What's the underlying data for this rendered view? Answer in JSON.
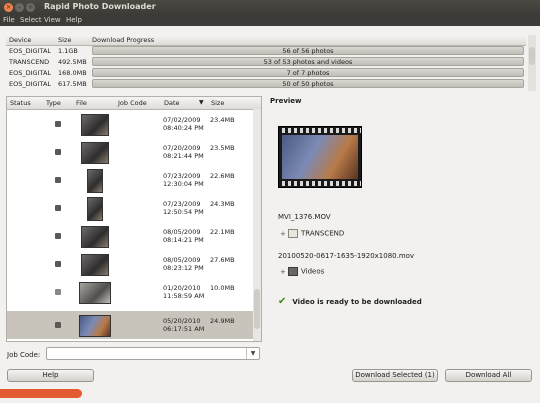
{
  "window": {
    "title": "Rapid Photo Downloader"
  },
  "menu": [
    "File",
    "Select",
    "View",
    "Help"
  ],
  "device_table": {
    "headers": {
      "device": "Device",
      "size": "Size",
      "progress": "Download Progress"
    },
    "rows": [
      {
        "device": "EOS_DIGITAL",
        "size": "1.1GB",
        "progress": "56 of 56 photos"
      },
      {
        "device": "TRANSCEND",
        "size": "492.5MB",
        "progress": "53 of 53 photos and videos"
      },
      {
        "device": "EOS_DIGITAL",
        "size": "168.0MB",
        "progress": "7 of 7 photos"
      },
      {
        "device": "EOS_DIGITAL",
        "size": "617.5MB",
        "progress": "50 of 50 photos"
      }
    ]
  },
  "file_table": {
    "headers": {
      "status": "Status",
      "type": "Type",
      "file": "File",
      "job_code": "Job Code",
      "date": "Date",
      "sort_icon": "▼",
      "size": "Size"
    },
    "rows": [
      {
        "date": "07/02/2009",
        "time": "08:40:24 PM",
        "size": "23.4MB"
      },
      {
        "date": "07/20/2009",
        "time": "08:21:44 PM",
        "size": "23.5MB"
      },
      {
        "date": "07/23/2009",
        "time": "12:30:04 PM",
        "size": "22.6MB"
      },
      {
        "date": "07/23/2009",
        "time": "12:50:54 PM",
        "size": "24.3MB"
      },
      {
        "date": "08/05/2009",
        "time": "08:14:21 PM",
        "size": "22.1MB"
      },
      {
        "date": "08/05/2009",
        "time": "08:23:12 PM",
        "size": "27.6MB"
      },
      {
        "date": "01/20/2010",
        "time": "11:58:59 AM",
        "size": "10.0MB"
      },
      {
        "date": "05/20/2010",
        "time": "06:17:51 AM",
        "size": "24.9MB"
      }
    ]
  },
  "preview": {
    "label": "Preview",
    "filename": "MVI_1376.MOV",
    "source_device": "TRANSCEND",
    "dest_filename": "20100520-0617-1635-1920x1080.mov",
    "dest_folder": "Videos",
    "status": "Video is ready to be downloaded"
  },
  "job_code": {
    "label": "Job Code:",
    "value": ""
  },
  "buttons": {
    "help": "Help",
    "download_selected": "Download Selected (1)",
    "download_all": "Download All"
  },
  "colors": {
    "accent": "#e35a33",
    "selection": "#c9c4bb",
    "ready_check": "#3a8a1a"
  }
}
